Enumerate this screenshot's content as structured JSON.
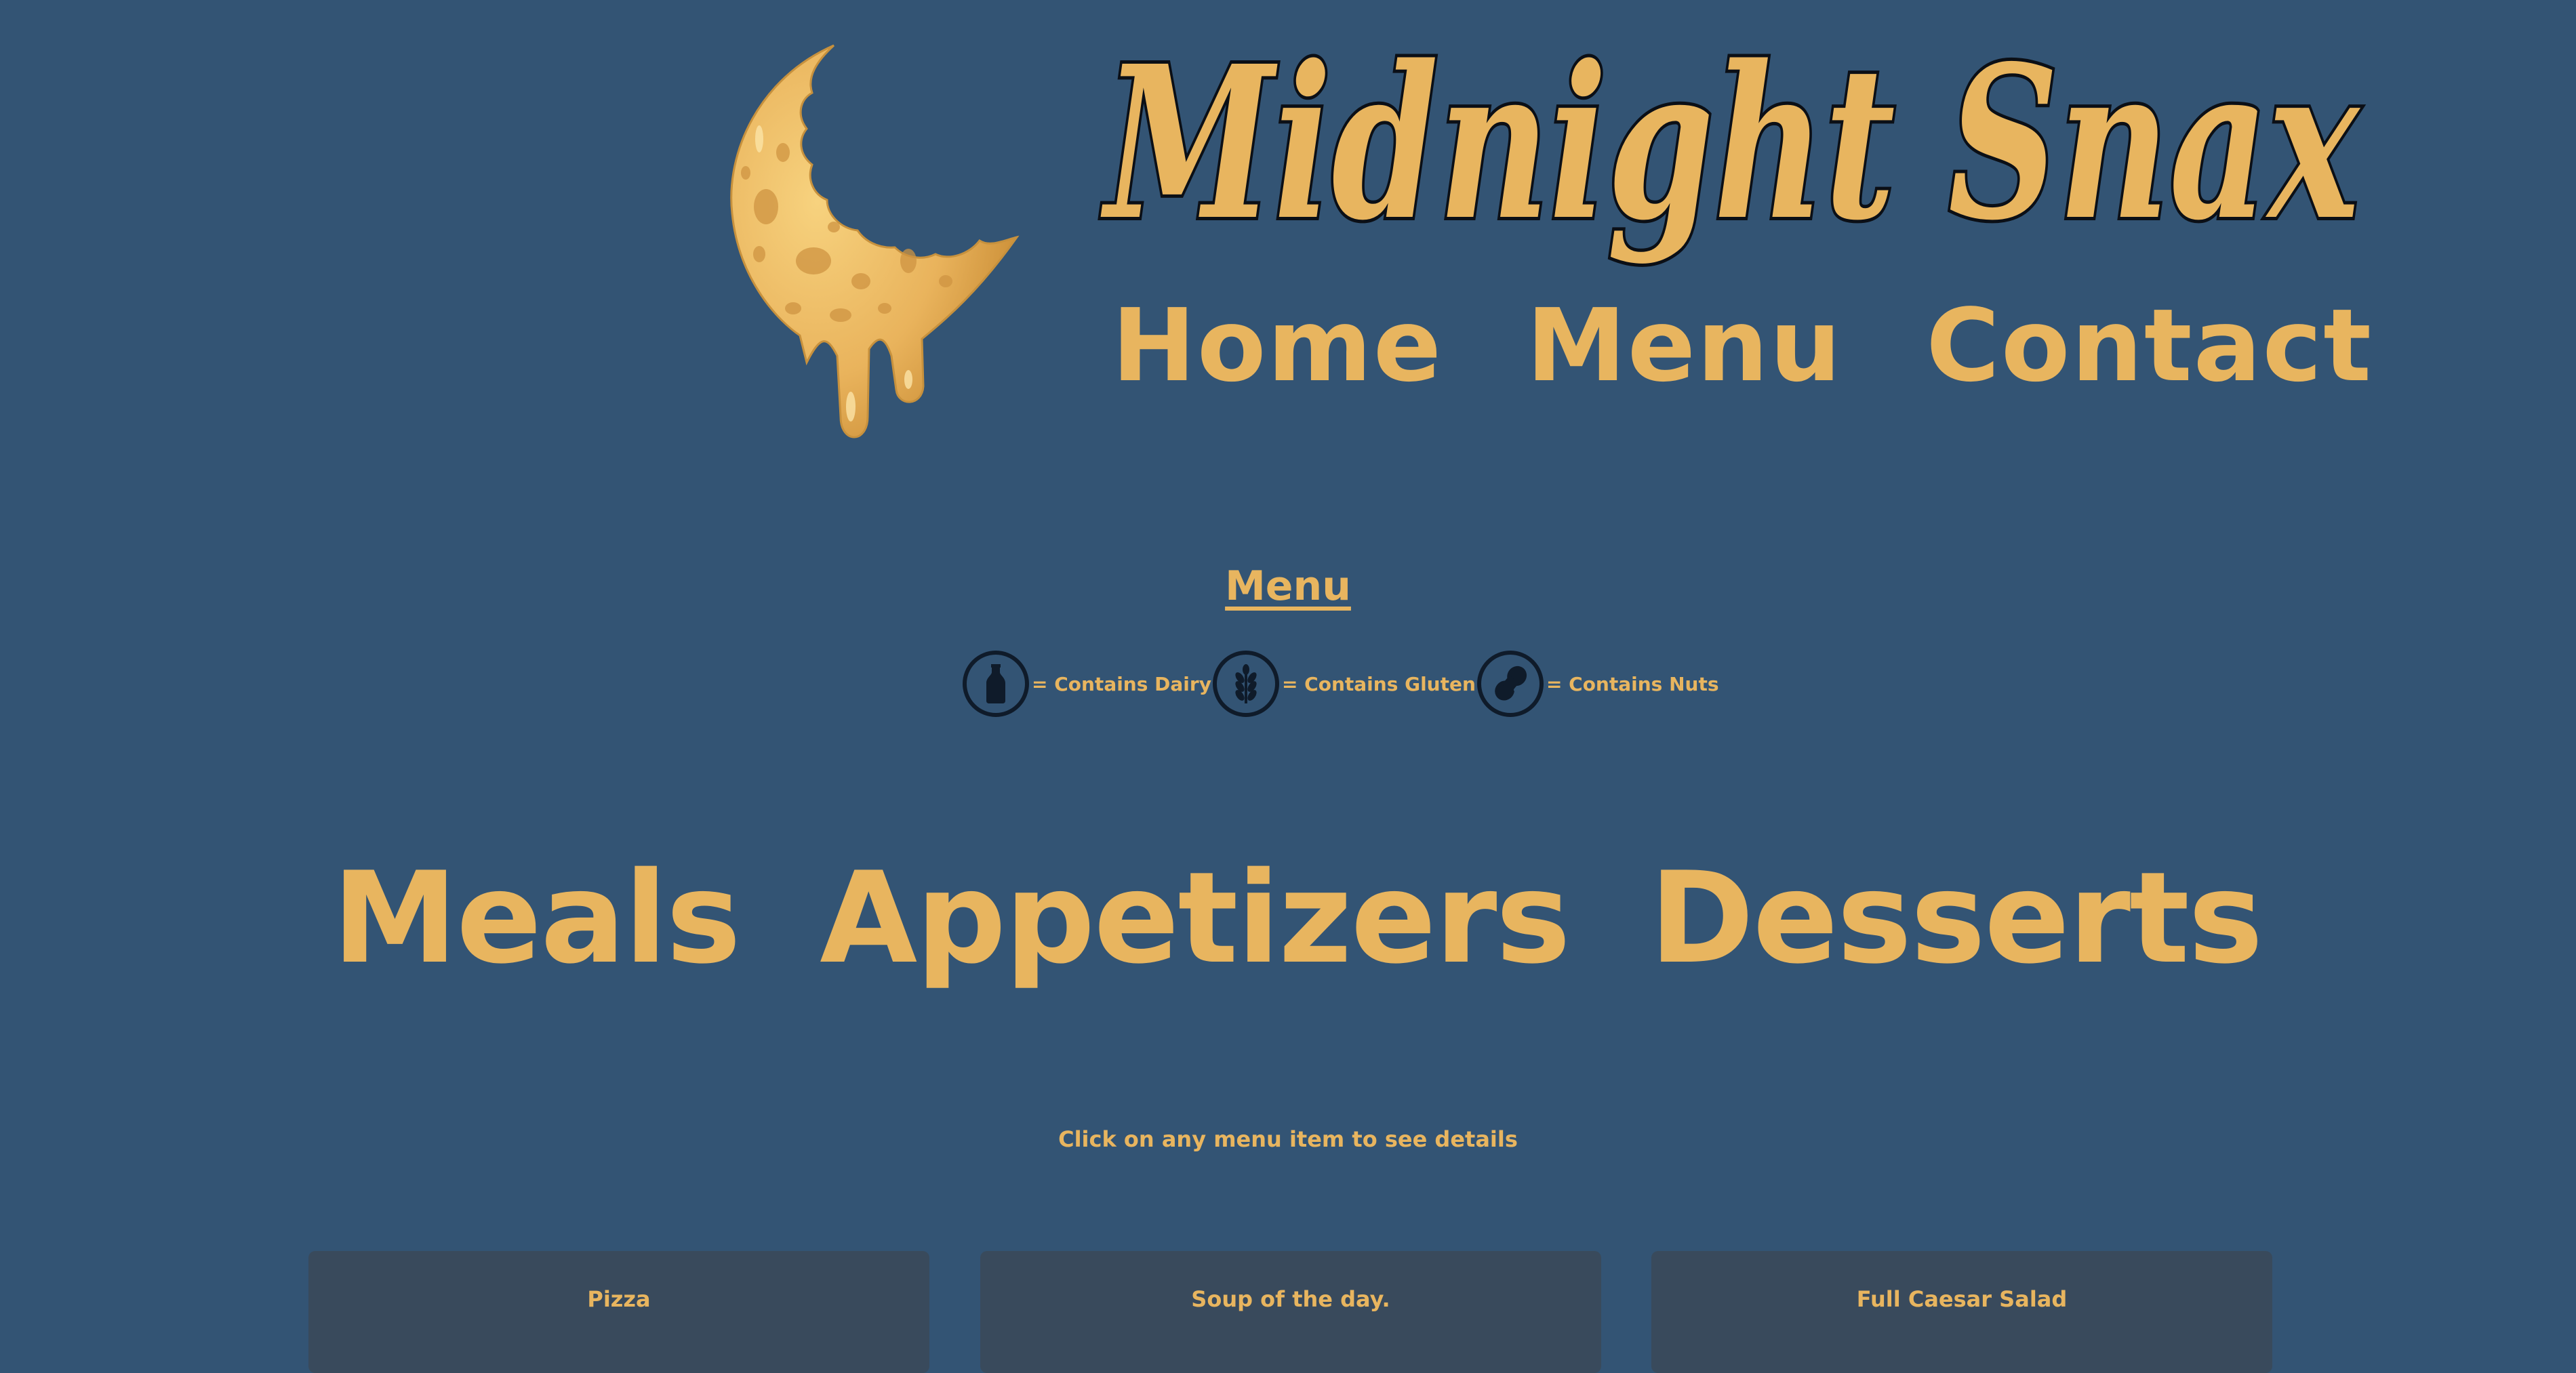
{
  "brand": {
    "title": "Midnight Snax",
    "logo_icon": "melting-cheese-moon-icon"
  },
  "nav": {
    "items": [
      "Home",
      "Menu",
      "Contact"
    ]
  },
  "menu_section": {
    "heading": "Menu",
    "legend": [
      {
        "icon": "milk-bottle-icon",
        "text": "= Contains Dairy"
      },
      {
        "icon": "wheat-icon",
        "text": "= Contains Gluten"
      },
      {
        "icon": "peanut-icon",
        "text": "= Contains Nuts"
      }
    ],
    "categories": [
      "Meals",
      "Appetizers",
      "Desserts"
    ],
    "hint": "Click on any menu item to see details",
    "items": [
      "Pizza",
      "Soup of the day.",
      "Full Caesar Salad"
    ]
  },
  "colors": {
    "background": "#335474",
    "accent": "#e8b55f",
    "card": "#394a5c",
    "outline": "#0f1b2a"
  }
}
